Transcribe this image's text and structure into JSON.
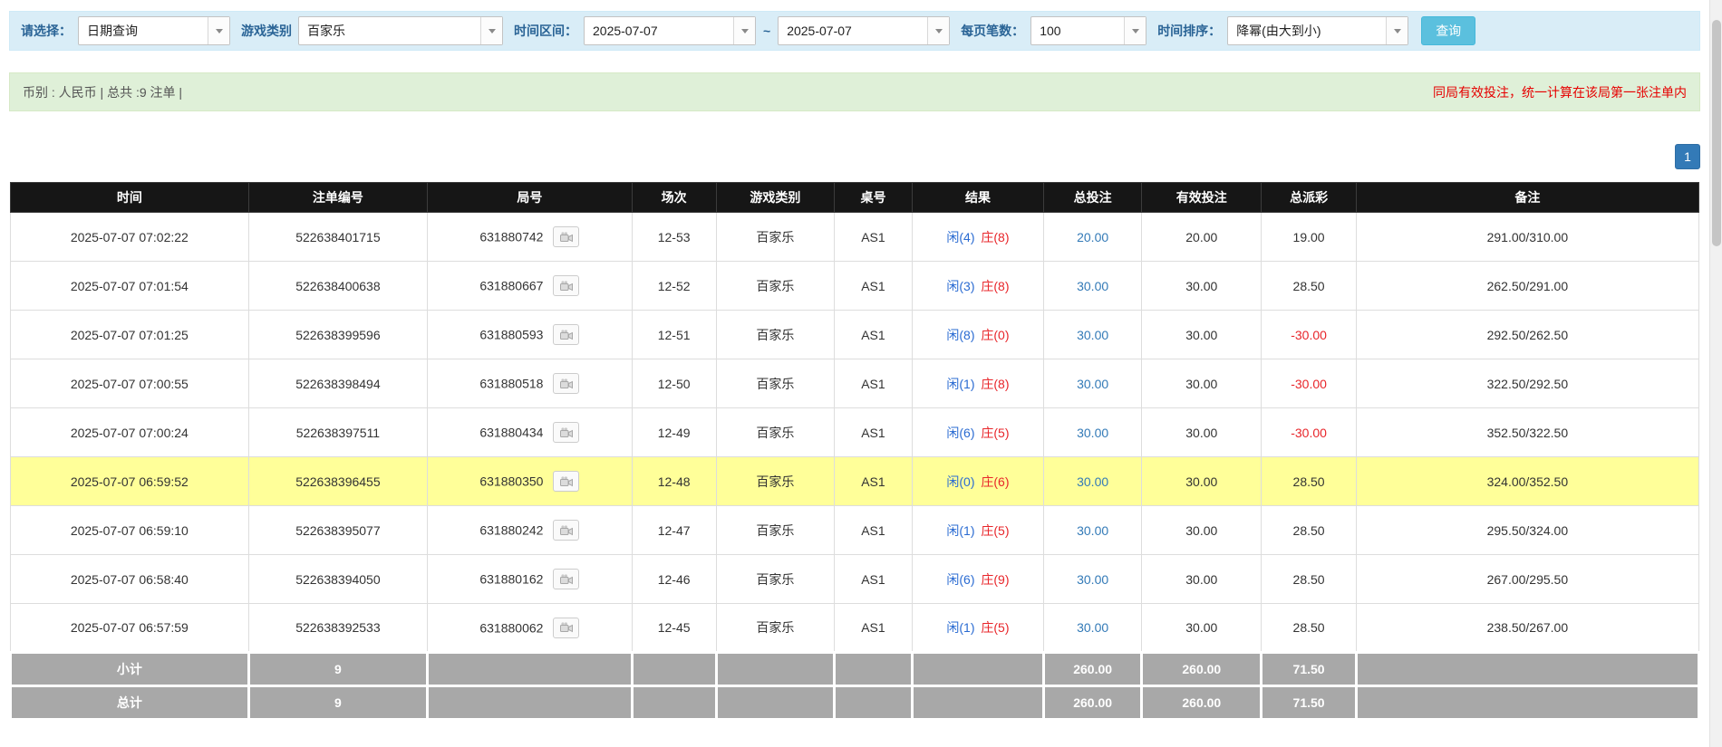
{
  "filters": {
    "select_label": "请选择：",
    "query_type": "日期查询",
    "game_type_label": "游戏类别",
    "game_type": "百家乐",
    "time_range_label": "时间区间：",
    "date_from": "2025-07-07",
    "range_separator": "~",
    "date_to": "2025-07-07",
    "page_size_label": "每页笔数：",
    "page_size": "100",
    "sort_label": "时间排序：",
    "sort_order": "降幂(由大到小)",
    "search_button": "查询"
  },
  "summary_bar": {
    "left_text": "币别 : 人民币 | 总共 :9 注单 |",
    "right_text": "同局有效投注，统一计算在该局第一张注单内"
  },
  "pagination": {
    "current_page": "1"
  },
  "table": {
    "headers": [
      "时间",
      "注单编号",
      "局号",
      "场次",
      "游戏类别",
      "桌号",
      "结果",
      "总投注",
      "有效投注",
      "总派彩",
      "备注"
    ],
    "rows": [
      {
        "time": "2025-07-07 07:02:22",
        "bet_id": "522638401715",
        "round_id": "631880742",
        "session": "12-53",
        "game": "百家乐",
        "table_no": "AS1",
        "player": "闲(4)",
        "banker": "庄(8)",
        "total_bet": "20.00",
        "valid_bet": "20.00",
        "payout": "19.00",
        "payout_negative": false,
        "note": "291.00/310.00",
        "highlighted": false
      },
      {
        "time": "2025-07-07 07:01:54",
        "bet_id": "522638400638",
        "round_id": "631880667",
        "session": "12-52",
        "game": "百家乐",
        "table_no": "AS1",
        "player": "闲(3)",
        "banker": "庄(8)",
        "total_bet": "30.00",
        "valid_bet": "30.00",
        "payout": "28.50",
        "payout_negative": false,
        "note": "262.50/291.00",
        "highlighted": false
      },
      {
        "time": "2025-07-07 07:01:25",
        "bet_id": "522638399596",
        "round_id": "631880593",
        "session": "12-51",
        "game": "百家乐",
        "table_no": "AS1",
        "player": "闲(8)",
        "banker": "庄(0)",
        "total_bet": "30.00",
        "valid_bet": "30.00",
        "payout": "-30.00",
        "payout_negative": true,
        "note": "292.50/262.50",
        "highlighted": false
      },
      {
        "time": "2025-07-07 07:00:55",
        "bet_id": "522638398494",
        "round_id": "631880518",
        "session": "12-50",
        "game": "百家乐",
        "table_no": "AS1",
        "player": "闲(1)",
        "banker": "庄(8)",
        "total_bet": "30.00",
        "valid_bet": "30.00",
        "payout": "-30.00",
        "payout_negative": true,
        "note": "322.50/292.50",
        "highlighted": false
      },
      {
        "time": "2025-07-07 07:00:24",
        "bet_id": "522638397511",
        "round_id": "631880434",
        "session": "12-49",
        "game": "百家乐",
        "table_no": "AS1",
        "player": "闲(6)",
        "banker": "庄(5)",
        "total_bet": "30.00",
        "valid_bet": "30.00",
        "payout": "-30.00",
        "payout_negative": true,
        "note": "352.50/322.50",
        "highlighted": false
      },
      {
        "time": "2025-07-07 06:59:52",
        "bet_id": "522638396455",
        "round_id": "631880350",
        "session": "12-48",
        "game": "百家乐",
        "table_no": "AS1",
        "player": "闲(0)",
        "banker": "庄(6)",
        "total_bet": "30.00",
        "valid_bet": "30.00",
        "payout": "28.50",
        "payout_negative": false,
        "note": "324.00/352.50",
        "highlighted": true
      },
      {
        "time": "2025-07-07 06:59:10",
        "bet_id": "522638395077",
        "round_id": "631880242",
        "session": "12-47",
        "game": "百家乐",
        "table_no": "AS1",
        "player": "闲(1)",
        "banker": "庄(5)",
        "total_bet": "30.00",
        "valid_bet": "30.00",
        "payout": "28.50",
        "payout_negative": false,
        "note": "295.50/324.00",
        "highlighted": false
      },
      {
        "time": "2025-07-07 06:58:40",
        "bet_id": "522638394050",
        "round_id": "631880162",
        "session": "12-46",
        "game": "百家乐",
        "table_no": "AS1",
        "player": "闲(6)",
        "banker": "庄(9)",
        "total_bet": "30.00",
        "valid_bet": "30.00",
        "payout": "28.50",
        "payout_negative": false,
        "note": "267.00/295.50",
        "highlighted": false
      },
      {
        "time": "2025-07-07 06:57:59",
        "bet_id": "522638392533",
        "round_id": "631880062",
        "session": "12-45",
        "game": "百家乐",
        "table_no": "AS1",
        "player": "闲(1)",
        "banker": "庄(5)",
        "total_bet": "30.00",
        "valid_bet": "30.00",
        "payout": "28.50",
        "payout_negative": false,
        "note": "238.50/267.00",
        "highlighted": false
      }
    ],
    "subtotal_label": "小计",
    "total_label": "总计",
    "subtotal": {
      "count": "9",
      "total_bet": "260.00",
      "valid_bet": "260.00",
      "payout": "71.50"
    },
    "total": {
      "count": "9",
      "total_bet": "260.00",
      "valid_bet": "260.00",
      "payout": "71.50"
    }
  },
  "colors": {
    "accent_blue": "#337ab7",
    "search_button_bg": "#5bc0de",
    "filter_bar_bg": "#d9edf7",
    "summary_bar_bg": "#dff0d8",
    "table_header_bg": "#161616",
    "table_footer_bg": "#a8a8a8",
    "highlight_row_bg": "#ffff99",
    "player_blue": "#2a6bd2",
    "banker_red": "#e8252a",
    "negative_red": "#e8252a",
    "alert_red": "#e60000"
  }
}
